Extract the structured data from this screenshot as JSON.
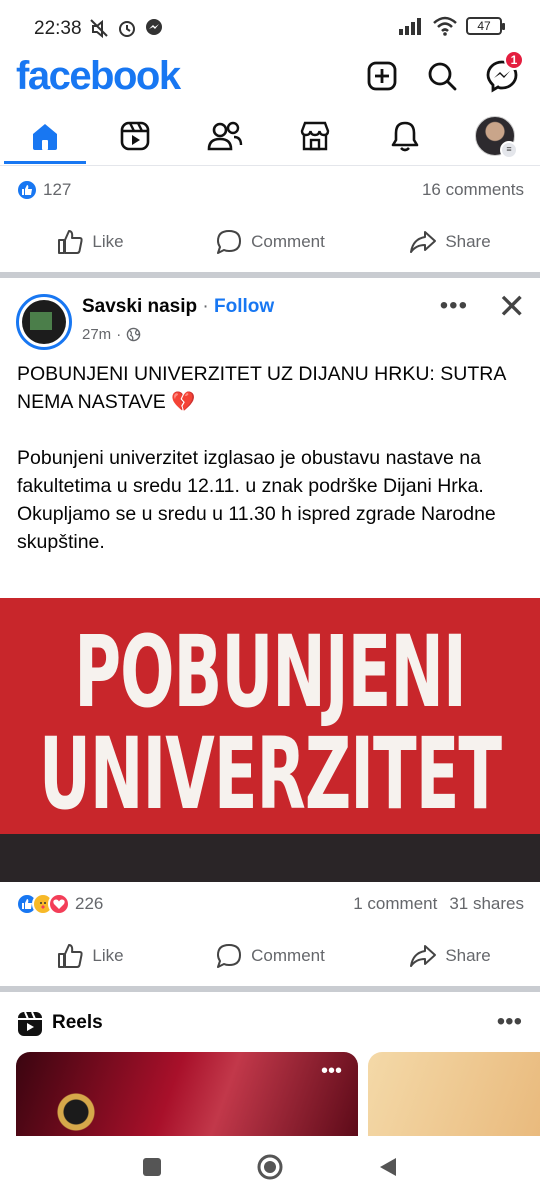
{
  "status_bar": {
    "time": "22:38",
    "battery": "47"
  },
  "app": {
    "logo": "facebook",
    "notification_count": "1"
  },
  "tabs": [
    {
      "name": "home",
      "icon": "home-icon",
      "active": true
    },
    {
      "name": "reels",
      "icon": "reels-icon"
    },
    {
      "name": "friends",
      "icon": "friends-icon"
    },
    {
      "name": "marketplace",
      "icon": "marketplace-icon"
    },
    {
      "name": "notifications",
      "icon": "bell-icon"
    },
    {
      "name": "profile",
      "icon": "profile-avatar"
    }
  ],
  "previous_post": {
    "reaction_count": "127",
    "comments": "16 comments",
    "actions": {
      "like": "Like",
      "comment": "Comment",
      "share": "Share"
    }
  },
  "post": {
    "page_name": "Savski nasip",
    "separator": "·",
    "follow": "Follow",
    "time": "27m",
    "text": "POBUNJENI UNIVERZITET UZ DIJANU HRKU: SUTRA NEMA NASTAVE 💔\n\nPobunjeni univerzitet izglasao je obustavu nastave na fakultetima u sredu 12.11. u znak podrške Dijani Hrka.\nOkupljamo se u sredu u 11.30 h ispred zgrade Narodne skupštine.",
    "image": {
      "line1": "POBUNJENI",
      "line2": "UNIVERZITET",
      "bg_color": "#c8262b"
    },
    "reaction_count": "226",
    "comments": "1 comment",
    "shares": "31 shares",
    "actions": {
      "like": "Like",
      "comment": "Comment",
      "share": "Share"
    }
  },
  "reels": {
    "title": "Reels"
  },
  "colors": {
    "brand": "#1877f2",
    "muted": "#65676b",
    "badge": "#e41e3f"
  }
}
